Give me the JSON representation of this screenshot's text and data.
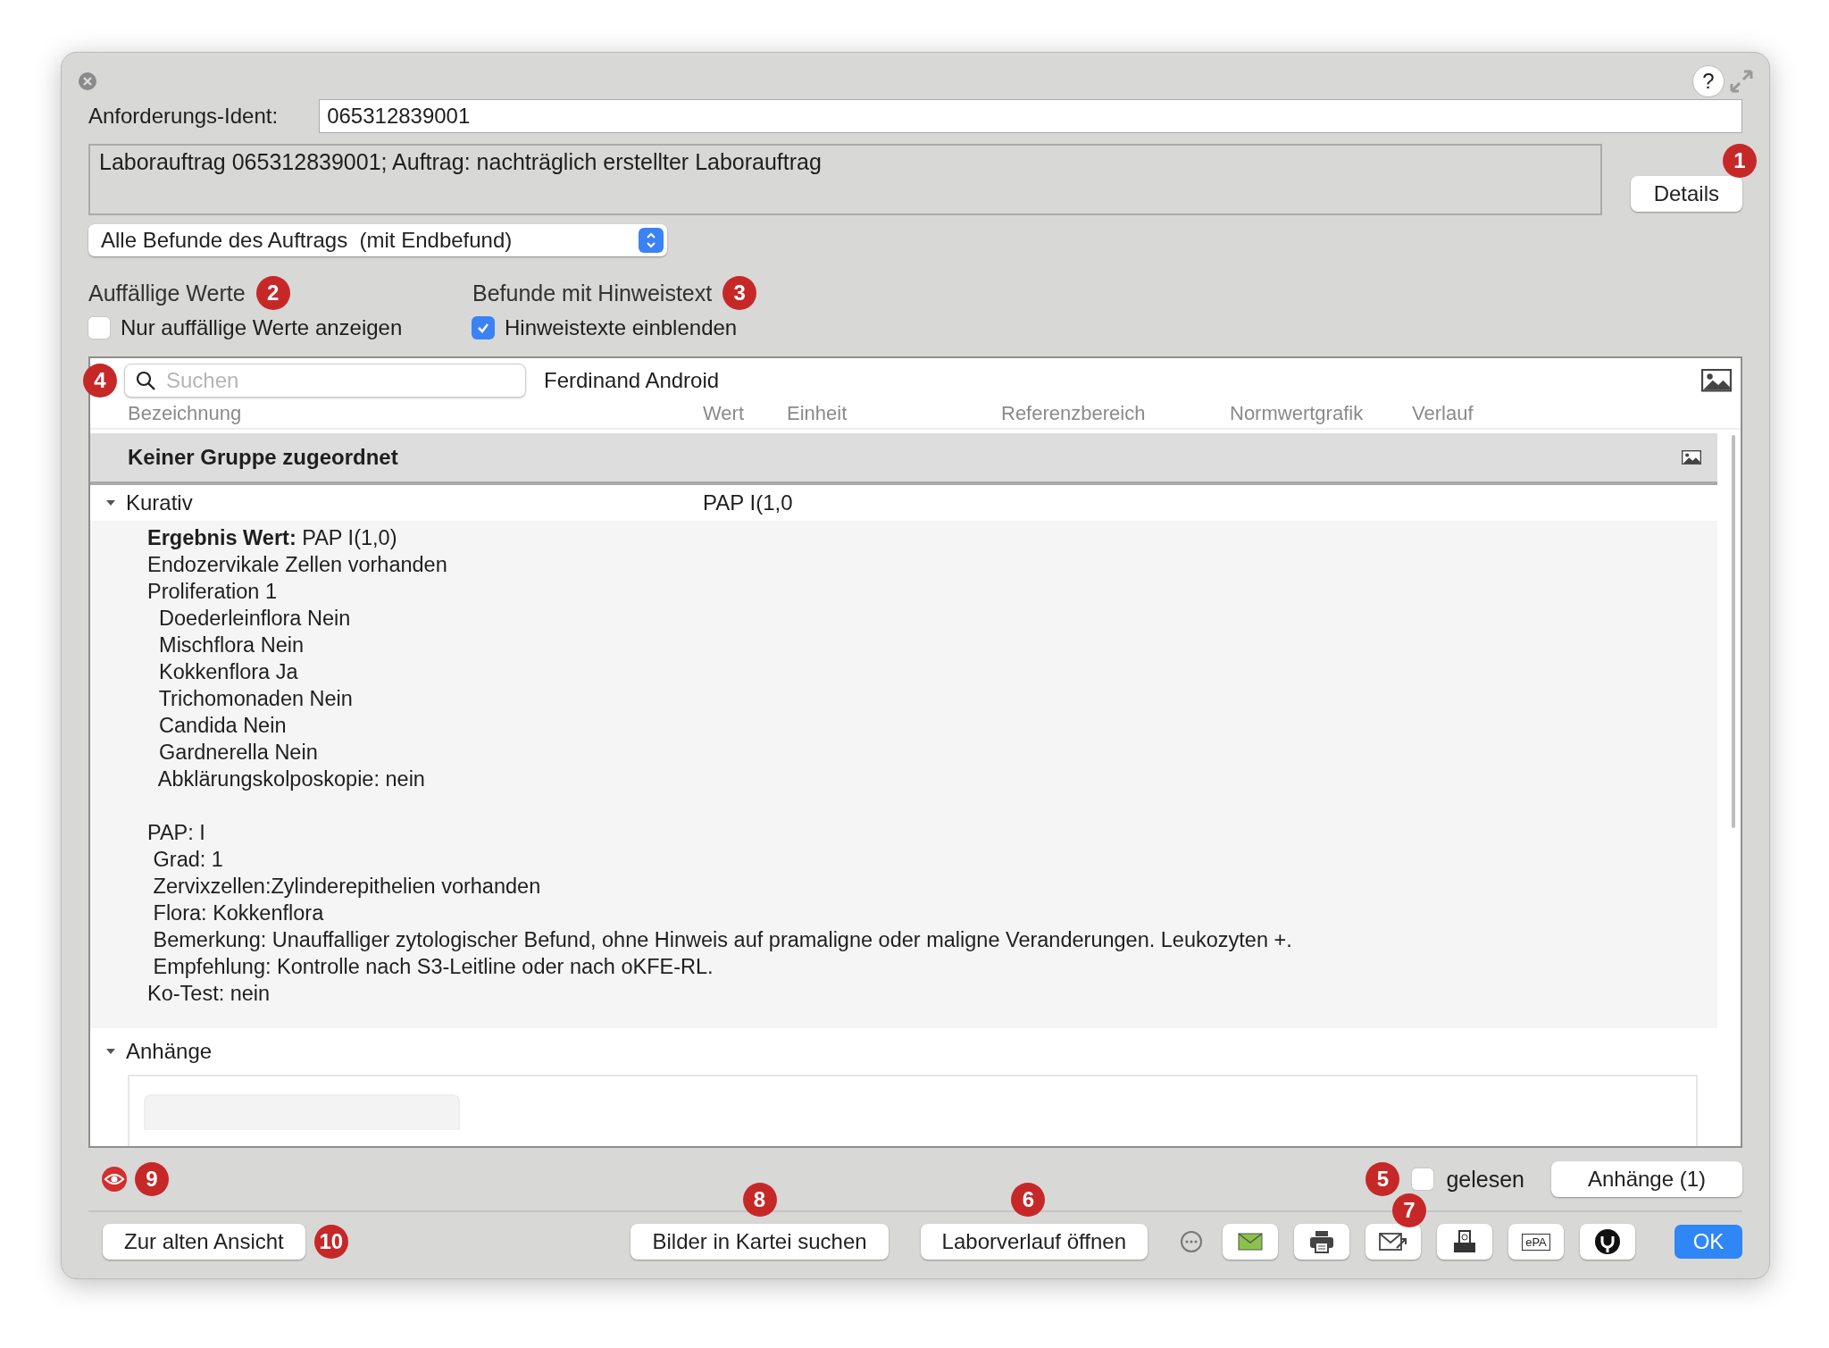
{
  "window": {
    "help": "?",
    "ident_label": "Anforderungs-Ident:",
    "ident_value": "065312839001",
    "description": "Laborauftrag 065312839001; Auftrag: nachträglich erstellter Laborauftrag",
    "details_button": {
      "label": "Details",
      "badge": "1"
    },
    "filter_select": "Alle Befunde des Auftrags  (mit Endbefund)"
  },
  "options": [
    {
      "heading": "Auffällige Werte",
      "badge": "2",
      "checkbox": "Nur auffällige Werte anzeigen",
      "checked": false
    },
    {
      "heading": "Befunde mit Hinweistext",
      "badge": "3",
      "checkbox": "Hinweistexte einblenden",
      "checked": true
    }
  ],
  "table": {
    "badge": "4",
    "search": {
      "placeholder": "Suchen"
    },
    "patient": "Ferdinand Android",
    "columns": [
      "Bezeichnung",
      "Wert",
      "Einheit",
      "Referenzbereich",
      "Normwertgrafik",
      "Verlauf"
    ],
    "group": "Keiner Gruppe zugeordnet",
    "rows": [
      {
        "name": "Kurativ",
        "value": "PAP I(1,0",
        "expanded": true,
        "blocks": [
          [
            "**Ergebnis Wert:** PAP I(1,0)",
            "Endozervikale Zellen vorhanden",
            "Proliferation 1",
            "  Doederleinflora Nein",
            "  Mischflora Nein",
            "  Kokkenflora Ja",
            "  Trichomonaden Nein",
            "  Candida Nein",
            "  Gardnerella Nein",
            "  Abklärungskolposkopie: nein"
          ],
          [
            "PAP: I",
            " Grad: 1",
            " Zervixzellen:Zylinderepithelien vorhanden",
            " Flora: Kokkenflora",
            " Bemerkung: Unauffalliger zytologischer Befund, ohne Hinweis auf pramaligne oder maligne Veranderungen. Leukozyten +.",
            " Empfehlung: Kontrolle nach S3-Leitline oder nach oKFE-RL.",
            "Ko-Test: nein"
          ]
        ]
      }
    ],
    "attachments": {
      "label": "Anhänge",
      "expanded": true
    }
  },
  "status": {
    "eye_badge": "9",
    "read": {
      "label": "gelesen",
      "checked": false,
      "badge": "5"
    },
    "attachments_button": "Anhänge (1)"
  },
  "footer": {
    "old_view": {
      "label": "Zur alten Ansicht",
      "badge": "10"
    },
    "search_images": {
      "label": "Bilder in Kartei suchen",
      "badge": "8"
    },
    "lab_history": {
      "label": "Laborverlauf öffnen",
      "badge": "6"
    },
    "tools": [
      {
        "kind": "more"
      },
      {
        "kind": "mail"
      },
      {
        "kind": "print"
      },
      {
        "kind": "send",
        "badge": "7"
      },
      {
        "kind": "fax"
      },
      {
        "kind": "epa",
        "label": "ePA"
      },
      {
        "kind": "plug"
      }
    ],
    "ok": "OK"
  }
}
